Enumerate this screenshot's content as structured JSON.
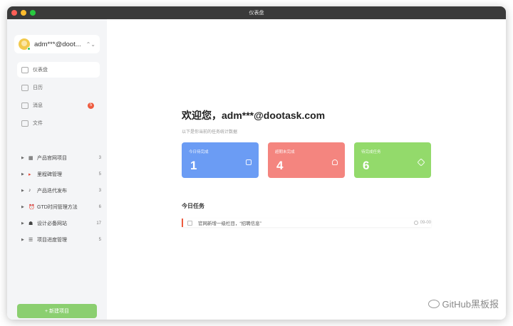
{
  "window": {
    "title": "仪表盘"
  },
  "user": {
    "name": "adm***@doot...",
    "caret": "⌃⌄"
  },
  "nav": [
    {
      "label": "仪表盘",
      "icon": "dashboard-icon",
      "active": true
    },
    {
      "label": "日历",
      "icon": "calendar-icon"
    },
    {
      "label": "消息",
      "icon": "message-icon",
      "badge": "5"
    },
    {
      "label": "文件",
      "icon": "file-icon"
    }
  ],
  "projects": [
    {
      "emoji": "▦",
      "name": "产品官网项目",
      "count": "3"
    },
    {
      "emoji": "▸",
      "name": "里程碑管理",
      "count": "5"
    },
    {
      "emoji": "♪",
      "name": "产品迭代发布",
      "count": "3"
    },
    {
      "emoji": "⏰",
      "name": "GTD时间管理方法",
      "count": "6"
    },
    {
      "emoji": "☗",
      "name": "设计必备网站",
      "count": "17"
    },
    {
      "emoji": "☰",
      "name": "项目进度管理",
      "count": "5"
    }
  ],
  "new_project_label": "+ 新建项目",
  "main": {
    "welcome": "欢迎您，adm***@dootask.com",
    "subtitle": "以下是你当前的任务统计数据",
    "cards": [
      {
        "label": "今日待完成",
        "value": "1",
        "color": "#6b9cf4",
        "icon": "calendar-icon"
      },
      {
        "label": "超期未完成",
        "value": "4",
        "color": "#f4857f",
        "icon": "alarm-icon"
      },
      {
        "label": "待完成任务",
        "value": "6",
        "color": "#93da6b",
        "icon": "cube-icon"
      }
    ],
    "tasks_title": "今日任务",
    "tasks": [
      {
        "text": "官网新增一级栏目，“招聘信息”",
        "time": "09-00"
      }
    ]
  },
  "watermark": "GitHub黑板报"
}
